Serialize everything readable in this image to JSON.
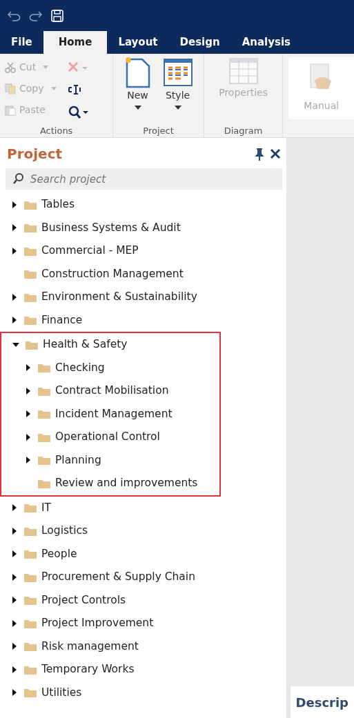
{
  "menu_tabs": [
    {
      "label": "File",
      "selected": false
    },
    {
      "label": "Home",
      "selected": true
    },
    {
      "label": "Layout",
      "selected": false
    },
    {
      "label": "Design",
      "selected": false
    },
    {
      "label": "Analysis",
      "selected": false
    }
  ],
  "ribbon": {
    "groups": [
      {
        "label": "Actions",
        "buttons": [
          {
            "kind": "cut",
            "label": "Cut",
            "disabled": true
          },
          {
            "kind": "copy",
            "label": "Copy",
            "disabled": true
          },
          {
            "kind": "paste",
            "label": "Paste",
            "disabled": true
          }
        ]
      },
      {
        "label": "Project",
        "buttons": [
          {
            "kind": "new",
            "label": "New",
            "disabled": false
          },
          {
            "kind": "style",
            "label": "Style",
            "disabled": false
          }
        ]
      },
      {
        "label": "Diagram",
        "buttons": [
          {
            "kind": "properties",
            "label": "Properties",
            "disabled": true
          }
        ]
      }
    ],
    "extra_button": {
      "label": "Manual",
      "disabled": true
    }
  },
  "panel": {
    "title": "Project",
    "search": {
      "placeholder": "Search project"
    },
    "tree": [
      {
        "label": "Tables",
        "expanded": false,
        "highlighted": false
      },
      {
        "label": "Business Systems & Audit",
        "expanded": false,
        "highlighted": false
      },
      {
        "label": "Commercial - MEP",
        "expanded": false,
        "highlighted": false
      },
      {
        "label": "Construction Management",
        "highlighted": false
      },
      {
        "label": "Environment & Sustainability",
        "expanded": false,
        "highlighted": false
      },
      {
        "label": "Finance",
        "expanded": false,
        "highlighted": false
      },
      {
        "label": "Health & Safety",
        "expanded": true,
        "highlighted": true,
        "children": [
          {
            "label": "Checking",
            "expanded": false,
            "highlighted": false
          },
          {
            "label": "Contract Mobilisation",
            "expanded": false,
            "highlighted": false
          },
          {
            "label": "Incident Management",
            "expanded": false,
            "highlighted": false
          },
          {
            "label": "Operational Control",
            "expanded": false,
            "highlighted": false
          },
          {
            "label": "Planning",
            "expanded": false,
            "highlighted": false
          },
          {
            "label": "Review and improvements",
            "highlighted": false
          }
        ]
      },
      {
        "label": "IT",
        "expanded": false,
        "highlighted": false
      },
      {
        "label": "Logistics",
        "expanded": false,
        "highlighted": false
      },
      {
        "label": "People",
        "expanded": false,
        "highlighted": false
      },
      {
        "label": "Procurement & Supply Chain",
        "expanded": false,
        "highlighted": false
      },
      {
        "label": "Project Controls",
        "expanded": false,
        "highlighted": false
      },
      {
        "label": "Project Improvement",
        "expanded": false,
        "highlighted": false
      },
      {
        "label": "Risk management",
        "expanded": false,
        "highlighted": false
      },
      {
        "label": "Temporary Works",
        "expanded": false,
        "highlighted": false
      },
      {
        "label": "Utilities",
        "expanded": false,
        "highlighted": false
      }
    ]
  },
  "description_panel": {
    "title": "Descrip"
  }
}
